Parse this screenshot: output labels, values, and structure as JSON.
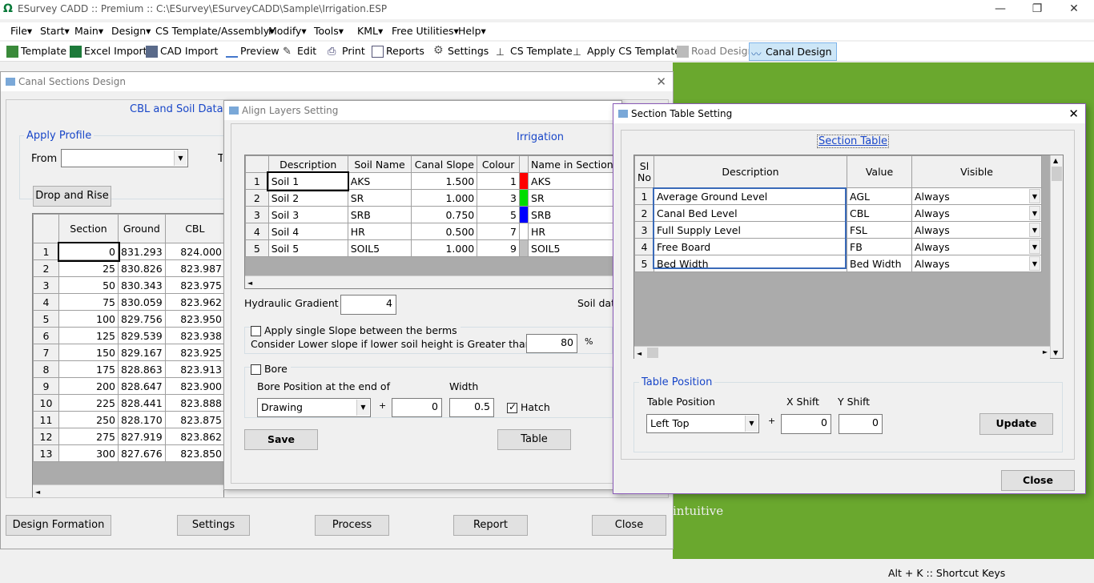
{
  "app": {
    "title": "ESurvey CADD :: Premium :: C:\\ESurvey\\ESurveyCADD\\Sample\\Irrigation.ESP"
  },
  "menu": [
    "File",
    "Start",
    "Main",
    "Design",
    "CS Template/Assembly",
    "Modify",
    "Tools",
    "KML",
    "Free Utilities",
    "Help"
  ],
  "toolbar": [
    "Template",
    "Excel Import",
    "CAD Import",
    "Preview",
    "Edit",
    "Print",
    "Reports",
    "Settings",
    "CS Template",
    "Apply CS Template",
    "Road Design",
    "Canal Design"
  ],
  "canal": {
    "title": "Canal Sections Design",
    "tab": "CBL and Soil Data",
    "apply_profile": "Apply Profile",
    "from": "From",
    "to": "To",
    "drop_rise": "Drop and Rise",
    "headers": [
      "Section",
      "Ground",
      "CBL"
    ],
    "rows": [
      [
        "1",
        "0",
        "831.293",
        "824.000"
      ],
      [
        "2",
        "25",
        "830.826",
        "823.987"
      ],
      [
        "3",
        "50",
        "830.343",
        "823.975"
      ],
      [
        "4",
        "75",
        "830.059",
        "823.962"
      ],
      [
        "5",
        "100",
        "829.756",
        "823.950"
      ],
      [
        "6",
        "125",
        "829.539",
        "823.938"
      ],
      [
        "7",
        "150",
        "829.167",
        "823.925"
      ],
      [
        "8",
        "175",
        "828.863",
        "823.913"
      ],
      [
        "9",
        "200",
        "828.647",
        "823.900"
      ],
      [
        "10",
        "225",
        "828.441",
        "823.888"
      ],
      [
        "11",
        "250",
        "828.170",
        "823.875"
      ],
      [
        "12",
        "275",
        "827.919",
        "823.862"
      ],
      [
        "13",
        "300",
        "827.676",
        "823.850"
      ]
    ],
    "buttons": [
      "Design Formation",
      "Settings",
      "Process",
      "Report",
      "Close"
    ]
  },
  "align": {
    "title": "Align Layers Setting",
    "heading": "Irrigation",
    "headers": [
      "Description",
      "Soil Name",
      "Canal Slope",
      "Colour",
      "Name in Section"
    ],
    "rows": [
      [
        "1",
        "Soil 1",
        "AKS",
        "1.500",
        "1",
        "#ff0000",
        "AKS"
      ],
      [
        "2",
        "Soil 2",
        "SR",
        "1.000",
        "3",
        "#00dd00",
        "SR"
      ],
      [
        "3",
        "Soil 3",
        "SRB",
        "0.750",
        "5",
        "#0000ff",
        "SRB"
      ],
      [
        "4",
        "Soil 4",
        "HR",
        "0.500",
        "7",
        "#ffffff",
        "HR"
      ],
      [
        "5",
        "Soil 5",
        "SOIL5",
        "1.000",
        "9",
        "#c0c0c0",
        "SOIL5"
      ]
    ],
    "hg_label": "Hydraulic Gradient",
    "hg_value": "4",
    "soil_data": "Soil dat",
    "single_slope": "Apply single Slope between the berms",
    "lower_slope": "Consider Lower slope if lower soil height is Greater than",
    "lower_value": "80",
    "percent": "%",
    "bore": "Bore",
    "bore_pos": "Bore Position at the end of",
    "width": "Width",
    "bore_combo": "Drawing",
    "plus": "+",
    "bore_x": "0",
    "bore_w": "0.5",
    "hatch": "Hatch",
    "save": "Save",
    "table": "Table"
  },
  "section": {
    "title": "Section Table Setting",
    "heading": "Section Table",
    "headers": [
      "Sl No",
      "Description",
      "Value",
      "Visible"
    ],
    "rows": [
      [
        "1",
        "Average Ground Level",
        "AGL",
        "Always"
      ],
      [
        "2",
        "Canal Bed Level",
        "CBL",
        "Always"
      ],
      [
        "3",
        "Full Supply Level",
        "FSL",
        "Always"
      ],
      [
        "4",
        "Free Board",
        "FB",
        "Always"
      ],
      [
        "5",
        "Bed Width",
        "Bed Width",
        "Always"
      ]
    ],
    "tp_group": "Table Position",
    "tp_label": "Table Position",
    "x_shift": "X Shift",
    "y_shift": "Y Shift",
    "tp_combo": "Left Top",
    "plus": "+",
    "x_val": "0",
    "y_val": "0",
    "update": "Update",
    "close": "Close"
  },
  "background": {
    "brand_text": "intuitive"
  },
  "status": {
    "shortcut": "Alt + K :: Shortcut Keys"
  }
}
